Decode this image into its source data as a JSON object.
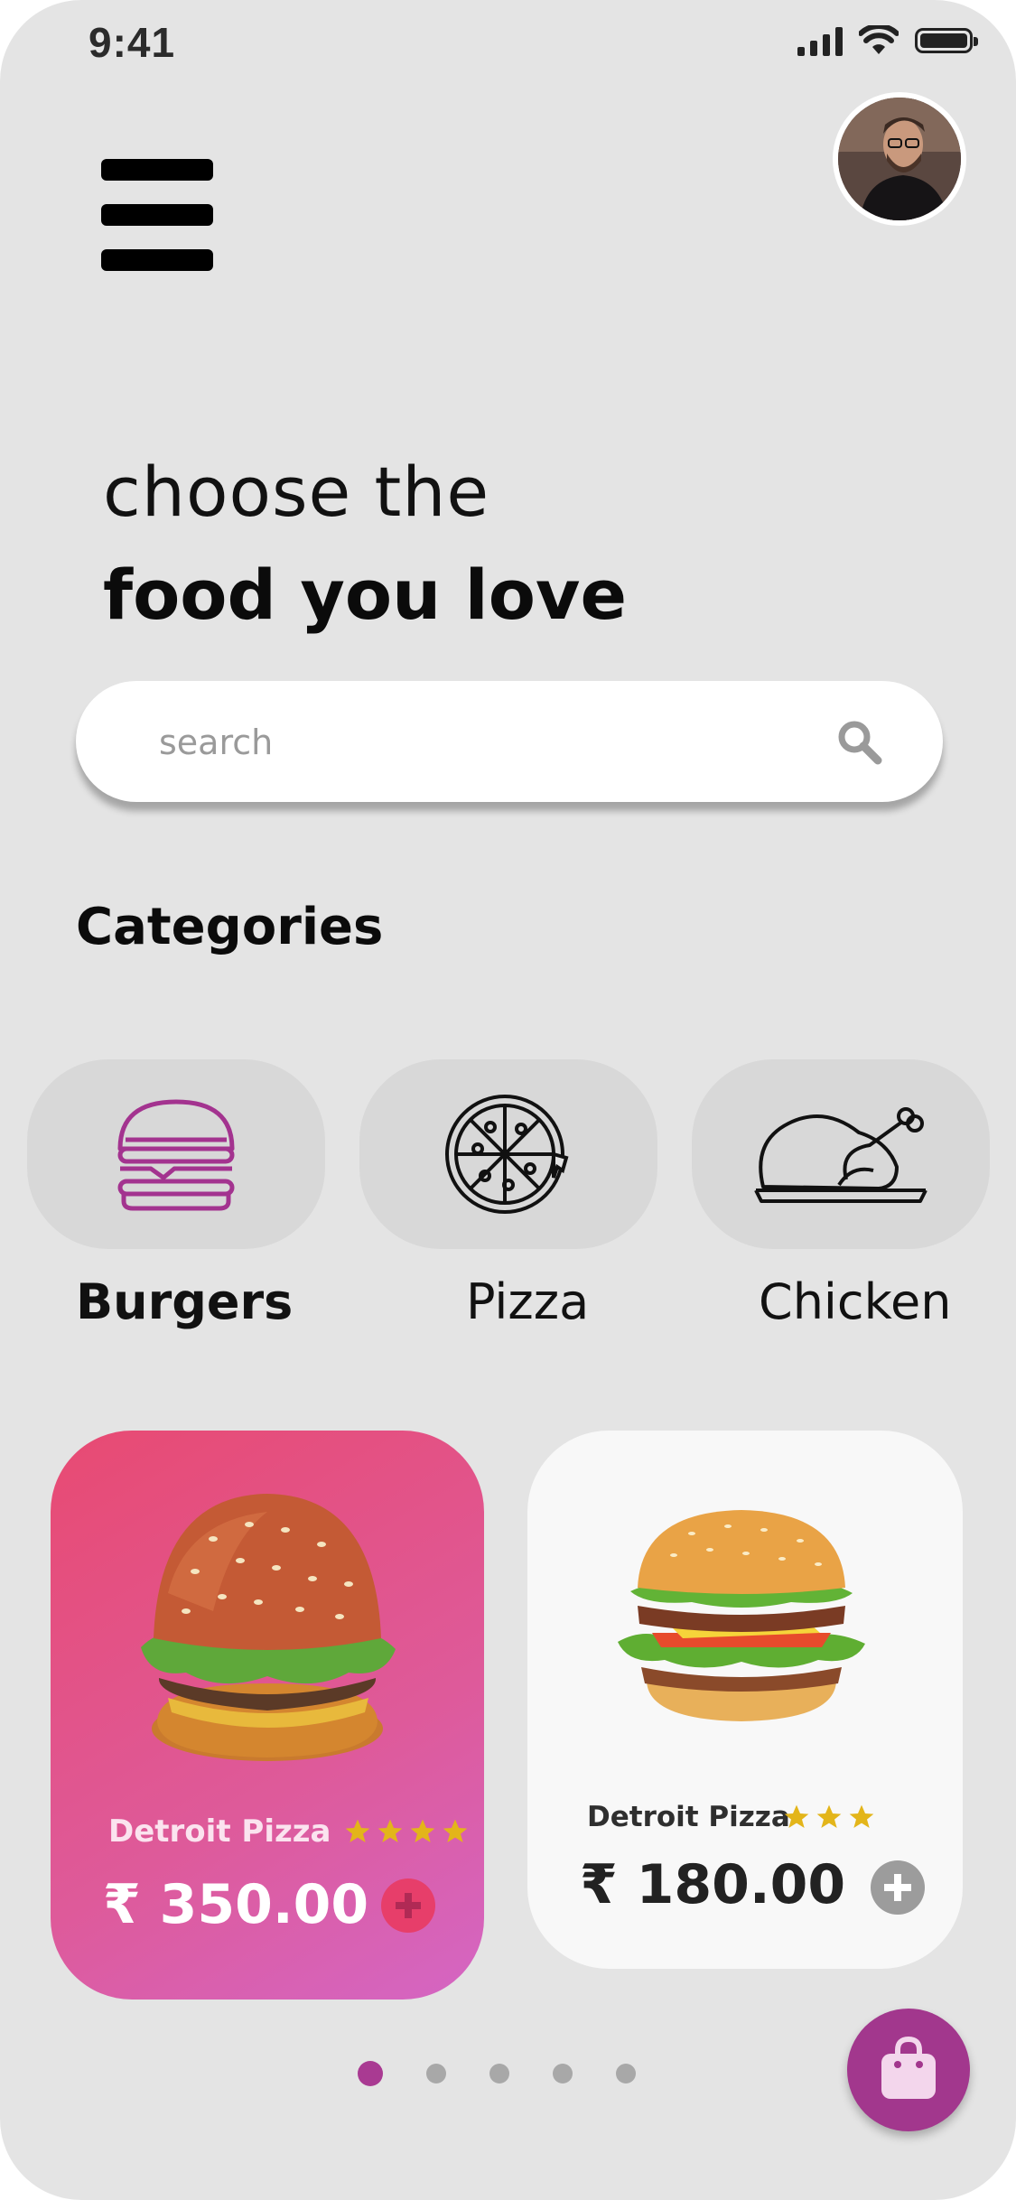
{
  "status_bar": {
    "time": "9:41"
  },
  "header": {
    "avatar_alt": "user profile photo"
  },
  "hero": {
    "line1": "choose the",
    "line2": "food you love"
  },
  "search": {
    "placeholder": "search"
  },
  "categories": {
    "title": "Categories",
    "items": [
      {
        "label": "Burgers",
        "icon": "burger-icon",
        "active": true
      },
      {
        "label": "Pizza",
        "icon": "pizza-icon",
        "active": false
      },
      {
        "label": "Chicken",
        "icon": "chicken-icon",
        "active": false
      }
    ]
  },
  "products": [
    {
      "name": "Detroit Pizza",
      "price": "₹ 350.00",
      "rating": 4,
      "highlighted": true
    },
    {
      "name": "Detroit Pizza",
      "price": "₹ 180.00",
      "rating": 3,
      "highlighted": false
    }
  ],
  "pagination": {
    "count": 5,
    "active_index": 0
  },
  "colors": {
    "accent": "#a93a92",
    "card_pink_start": "#e84a72",
    "card_pink_end": "#d466c4",
    "star": "#e3b51a",
    "background": "#e4e4e4"
  },
  "fab": {
    "icon": "shopping-bag-icon"
  }
}
